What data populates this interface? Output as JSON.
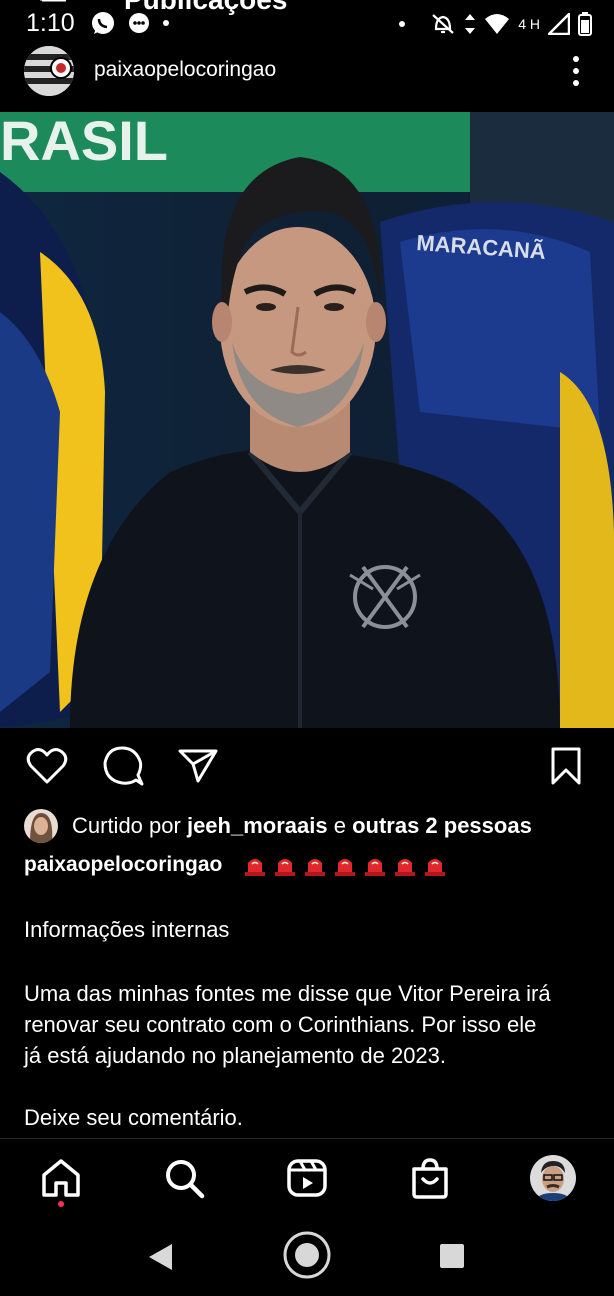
{
  "status_bar": {
    "time": "1:10",
    "network": "4 H"
  },
  "overlay_title": "Publicações",
  "post": {
    "username": "paixaopelocoringao",
    "likes": {
      "prefix": "Curtido por ",
      "user": "jeeh_moraais",
      "connector": " e ",
      "others": "outras 2 pessoas"
    },
    "caption_user": "paixaopelocoringao",
    "caption_lines": [
      "Informações internas",
      "Uma das minhas fontes me disse que Vitor Pereira irá",
      "renovar seu contrato com o Corinthians. Por isso ele",
      "já está ajudando no planejamento de 2023.",
      "Deixe seu comentário."
    ]
  },
  "icons": {
    "like": "heart-icon",
    "comment": "comment-icon",
    "share": "send-icon",
    "save": "bookmark-icon"
  },
  "colors": {
    "background": "#000000",
    "notification_dot": "#ff2d55",
    "siren": "#e0282e"
  }
}
